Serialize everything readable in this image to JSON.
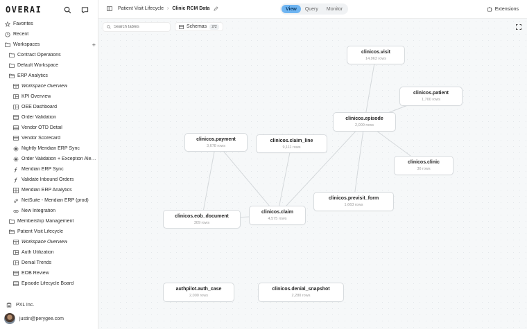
{
  "brand": "OVERAI",
  "sidebar": {
    "items": [
      {
        "label": "Favorites",
        "icon": "star-icon",
        "indent": 0,
        "italic": false
      },
      {
        "label": "Recent",
        "icon": "clock-icon",
        "indent": 0,
        "italic": false
      },
      {
        "label": "Workspaces",
        "icon": "folder-icon",
        "indent": 0,
        "italic": false,
        "action": "+"
      },
      {
        "label": "Contract Operations",
        "icon": "folder-icon",
        "indent": 1,
        "italic": false
      },
      {
        "label": "Default Workspace",
        "icon": "folder-icon",
        "indent": 1,
        "italic": false
      },
      {
        "label": "ERP Analytics",
        "icon": "folder-open-icon",
        "indent": 1,
        "italic": false
      },
      {
        "label": "Workspace Overview",
        "icon": "overview-icon",
        "indent": 2,
        "italic": true
      },
      {
        "label": "KPI Overview",
        "icon": "dashboard-icon",
        "indent": 2,
        "italic": false
      },
      {
        "label": "OEE Dashboard",
        "icon": "dashboard-icon",
        "indent": 2,
        "italic": false
      },
      {
        "label": "Order Validation",
        "icon": "table-icon",
        "indent": 2,
        "italic": false
      },
      {
        "label": "Vendor OTD Detail",
        "icon": "table-icon",
        "indent": 2,
        "italic": false
      },
      {
        "label": "Vendor Scorecard",
        "icon": "table-icon",
        "indent": 2,
        "italic": false
      },
      {
        "label": "Nightly Meridian ERP Sync",
        "icon": "sync-icon",
        "indent": 2,
        "italic": false
      },
      {
        "label": "Order Validation + Exception Ale…",
        "icon": "sync-icon",
        "indent": 2,
        "italic": false
      },
      {
        "label": "Meridian ERP Sync",
        "icon": "function-icon",
        "indent": 2,
        "italic": false
      },
      {
        "label": "Validate Inbound Orders",
        "icon": "function-icon",
        "indent": 2,
        "italic": false
      },
      {
        "label": "Meridian ERP Analytics",
        "icon": "grid-icon",
        "indent": 2,
        "italic": false
      },
      {
        "label": "NetSuite - Meridian ERP (prod)",
        "icon": "link-icon",
        "indent": 2,
        "italic": false
      },
      {
        "label": "New Integration",
        "icon": "integration-icon",
        "indent": 2,
        "italic": false
      },
      {
        "label": "Membership Management",
        "icon": "folder-icon",
        "indent": 1,
        "italic": false
      },
      {
        "label": "Patient Visit Lifecycle",
        "icon": "folder-open-icon",
        "indent": 1,
        "italic": false
      },
      {
        "label": "Workspace Overview",
        "icon": "overview-icon",
        "indent": 2,
        "italic": true
      },
      {
        "label": "Auth Utilization",
        "icon": "dashboard-icon",
        "indent": 2,
        "italic": false
      },
      {
        "label": "Denial Trends",
        "icon": "dashboard-icon",
        "indent": 2,
        "italic": false
      },
      {
        "label": "EOB Review",
        "icon": "table-icon",
        "indent": 2,
        "italic": false
      },
      {
        "label": "Episode Lifecycle Board",
        "icon": "table-icon",
        "indent": 2,
        "italic": false
      }
    ],
    "org": "PXL Inc.",
    "user_email": "justin@perygee.com"
  },
  "topbar": {
    "breadcrumb_parent": "Patient Visit Lifecycle",
    "breadcrumb_sep": "›",
    "breadcrumb_current": "Clinic RCM Data",
    "tabs": [
      {
        "label": "View",
        "active": true
      },
      {
        "label": "Query",
        "active": false
      },
      {
        "label": "Monitor",
        "active": false
      }
    ],
    "extensions_label": "Extensions"
  },
  "canvas": {
    "search_placeholder": "Search tables",
    "schemas_label": "Schemas",
    "schemas_count": "2/2",
    "nodes": [
      {
        "id": "visit",
        "name": "clinicos.visit",
        "rows": "14,963 rows"
      },
      {
        "id": "patient",
        "name": "clinicos.patient",
        "rows": "1,700 rows"
      },
      {
        "id": "episode",
        "name": "clinicos.episode",
        "rows": "2,000 rows"
      },
      {
        "id": "payment",
        "name": "clinicos.payment",
        "rows": "3,678 rows"
      },
      {
        "id": "claim_line",
        "name": "clinicos.claim_line",
        "rows": "9,111 rows"
      },
      {
        "id": "clinic",
        "name": "clinicos.clinic",
        "rows": "30 rows"
      },
      {
        "id": "previsit_form",
        "name": "clinicos.previsit_form",
        "rows": "1,663 rows"
      },
      {
        "id": "eob_document",
        "name": "clinicos.eob_document",
        "rows": "309 rows"
      },
      {
        "id": "claim",
        "name": "clinicos.claim",
        "rows": "4,575 rows"
      },
      {
        "id": "auth_case",
        "name": "authpilot.auth_case",
        "rows": "2,000 rows"
      },
      {
        "id": "denial_snapshot",
        "name": "clinicos.denial_snapshot",
        "rows": "2,280 rows"
      }
    ],
    "edges": [
      [
        "visit",
        "episode"
      ],
      [
        "patient",
        "episode"
      ],
      [
        "episode",
        "clinic"
      ],
      [
        "episode",
        "previsit_form"
      ],
      [
        "episode",
        "claim"
      ],
      [
        "payment",
        "eob_document"
      ],
      [
        "payment",
        "claim"
      ],
      [
        "claim_line",
        "claim"
      ],
      [
        "eob_document",
        "claim"
      ]
    ]
  }
}
